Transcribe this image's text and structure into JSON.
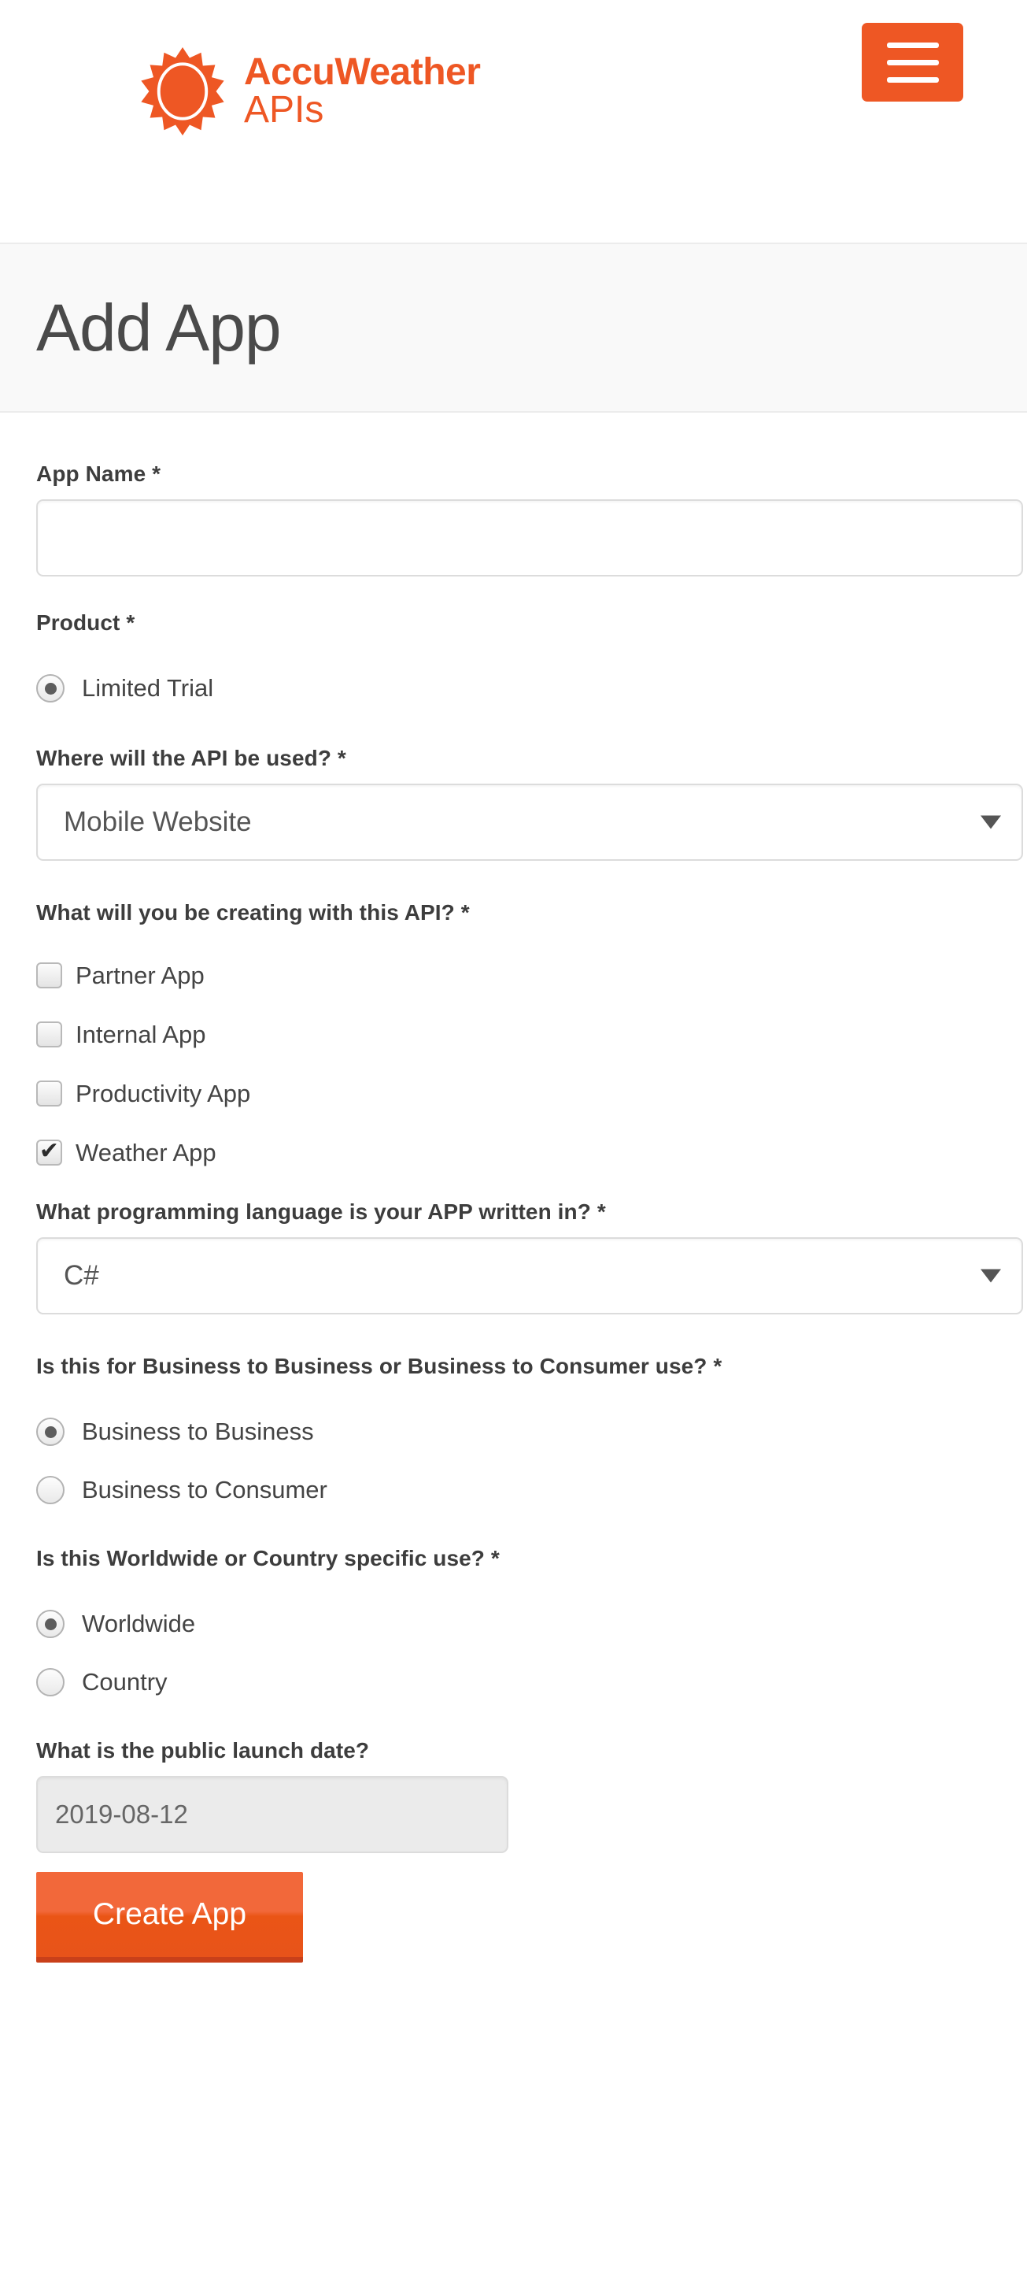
{
  "brand": {
    "logo_line1": "AccuWeather",
    "logo_line2": "APIs",
    "logo_color": "#ee5724",
    "sun_icon": "sun-icon"
  },
  "header": {
    "menu_button_label": "menu",
    "menu_icon": "hamburger-icon",
    "menu_bg_color": "#ee5724"
  },
  "page": {
    "title": "Add App",
    "title_band_bg": "#f9f9f9"
  },
  "form": {
    "app_name": {
      "label": "App Name *",
      "value": "",
      "placeholder": ""
    },
    "product": {
      "label": "Product *",
      "options": [
        {
          "label": "Limited Trial",
          "checked": true
        }
      ]
    },
    "api_location": {
      "label": "Where will the API be used? *",
      "selected": "Mobile Website"
    },
    "creating_with": {
      "label": "What will you be creating with this API? *",
      "options": [
        {
          "label": "Partner App",
          "checked": false
        },
        {
          "label": "Internal App",
          "checked": false
        },
        {
          "label": "Productivity App",
          "checked": false
        },
        {
          "label": "Weather App",
          "checked": true
        }
      ]
    },
    "language": {
      "label": "What programming language is your APP written in? *",
      "selected": "C#"
    },
    "b2b_b2c": {
      "label": "Is this for Business to Business or Business to Consumer use? *",
      "options": [
        {
          "label": "Business to Business",
          "checked": true
        },
        {
          "label": "Business to Consumer",
          "checked": false
        }
      ]
    },
    "scope": {
      "label": "Is this Worldwide or Country specific use? *",
      "options": [
        {
          "label": "Worldwide",
          "checked": true
        },
        {
          "label": "Country",
          "checked": false
        }
      ]
    },
    "launch_date": {
      "label": "What is the public launch date?",
      "value": "2019-08-12"
    },
    "submit": {
      "label": "Create App",
      "color": "#ea5516"
    }
  }
}
